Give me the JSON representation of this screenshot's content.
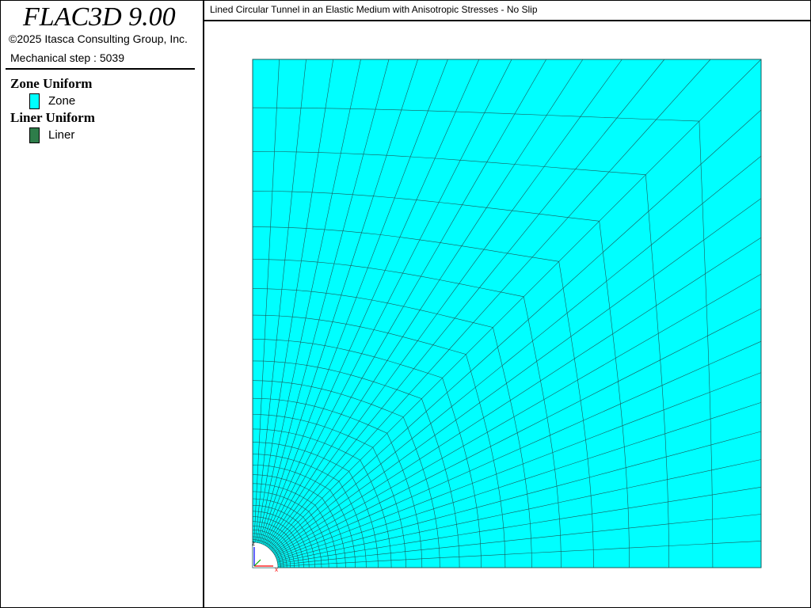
{
  "app": {
    "title": "FLAC3D 9.00",
    "copyright": "©2025 Itasca Consulting Group, Inc.",
    "step_text": "Mechanical step : 5039"
  },
  "legend": {
    "zone": {
      "title": "Zone Uniform",
      "label": "Zone",
      "color": "#00ffff"
    },
    "liner": {
      "title": "Liner Uniform",
      "label": "Liner",
      "color": "#2e7d4a"
    }
  },
  "plot": {
    "title": "Lined Circular Tunnel in an Elastic Medium with Anisotropic Stresses - No Slip",
    "mesh_fill": "#00ffff",
    "mesh_line": "#1a5a5a",
    "axes": {
      "z_label": "z",
      "x_label": "x",
      "z_color": "#0000ff",
      "x_color": "#ff0000",
      "y_color": "#00aa00"
    }
  }
}
